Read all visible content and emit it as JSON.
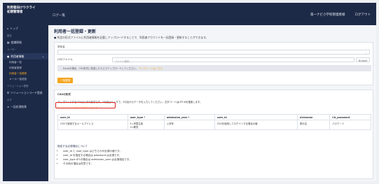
{
  "sidebar": {
    "brand_line1": "利用者向けウクライ",
    "brand_line2": "初期管理者",
    "items": [
      {
        "label": "トップ",
        "type": "nav"
      },
      {
        "label": "設定",
        "type": "section"
      },
      {
        "label": "組織情報",
        "type": "nav"
      },
      {
        "label": "ユーザー",
        "type": "section"
      },
      {
        "label": "利用者情報",
        "type": "nav-open"
      },
      {
        "label": "利用者一覧",
        "type": "sub"
      },
      {
        "label": "利用者登録",
        "type": "sub"
      },
      {
        "label": "利用者一括登録",
        "type": "sub-active"
      },
      {
        "label": "メール一括送信",
        "type": "sub"
      },
      {
        "label": "ソリューション登録",
        "type": "section"
      },
      {
        "label": "ソリューションコード登録",
        "type": "nav"
      },
      {
        "label": "ログ",
        "type": "section"
      },
      {
        "label": "一括処理結果",
        "type": "nav"
      }
    ]
  },
  "topbar": {
    "title": "ログ一覧",
    "org": "第一ナビ小学校管理者様",
    "logout": "ログアウト"
  },
  "main": {
    "title": "利用者一括登録・更新",
    "info": "所定の形式ファイルに利用者情報を記載しアップロードすることで、利用者アカウントを一括登録・更新することができます。",
    "group_label": "学年名",
    "file_label": "CSVファイル",
    "file_placeholder": "ファイル選択...",
    "browse": "Browse",
    "note_text": "Excelの場合、CSV形式に変換したうえでアップロードしてください。",
    "note_link": "テンプレートはこちら",
    "submit": "一括登録",
    "csv_heading": "CSVの形式",
    "csv_desc": "アップロードするCSVは以下の形式です。1行目はヘッダで、2行目からデータを入力してください。文字コードはUTF-8を推奨します。",
    "csv_highlight": "テンプレートファイルのダウンロード",
    "table": {
      "headers": [
        "user_id",
        "user_type *",
        "admission_year *",
        "user_id",
        "nickname",
        "CA_password"
      ],
      "row": [
        "CSVで使用するメールアドレス",
        "1=児童生徒\n2=教員",
        "入学年",
        "CSVを使用してログインする場合の値",
        "表示名",
        "パスワード"
      ]
    },
    "rules_title": "指定する必須項目について",
    "rules": [
      "user_id と user_type はどちらかが必須の値です。",
      "user_id を指定する場合は password は必須です。",
      "user_type が1の場合は admission_year は必須項目です。",
      "その他の項目は任意です。"
    ]
  }
}
